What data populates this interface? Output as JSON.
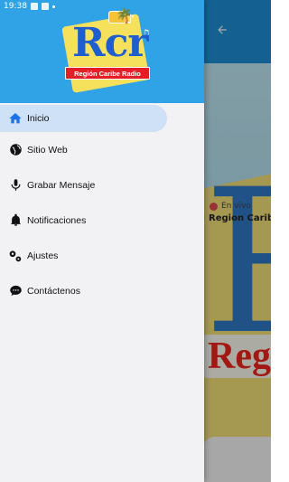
{
  "status_bar": {
    "time": "19:38"
  },
  "app": {
    "back_icon": "arrow-left-icon",
    "live_label": "En vivo",
    "station_name": "Region Caribe",
    "hero_region_text": "Regió"
  },
  "drawer": {
    "logo": {
      "letters": "Rcr",
      "banner": "Región Caribe Radio"
    },
    "menu": [
      {
        "label": "Inicio",
        "icon": "home-icon",
        "active": true
      },
      {
        "label": "Sitio Web",
        "icon": "globe-icon",
        "active": false
      },
      {
        "label": "Grabar Mensaje",
        "icon": "microphone-icon",
        "active": false
      },
      {
        "label": "Notificaciones",
        "icon": "bell-icon",
        "active": false
      },
      {
        "label": "Ajustes",
        "icon": "gears-icon",
        "active": false
      },
      {
        "label": "Contáctenos",
        "icon": "chat-bubble-icon",
        "active": false
      }
    ]
  },
  "colors": {
    "header_blue": "#2fa3e6",
    "active_item_bg": "#cfe1f6",
    "home_icon_blue": "#1a73e8",
    "live_dot_red": "#e24b4b"
  }
}
